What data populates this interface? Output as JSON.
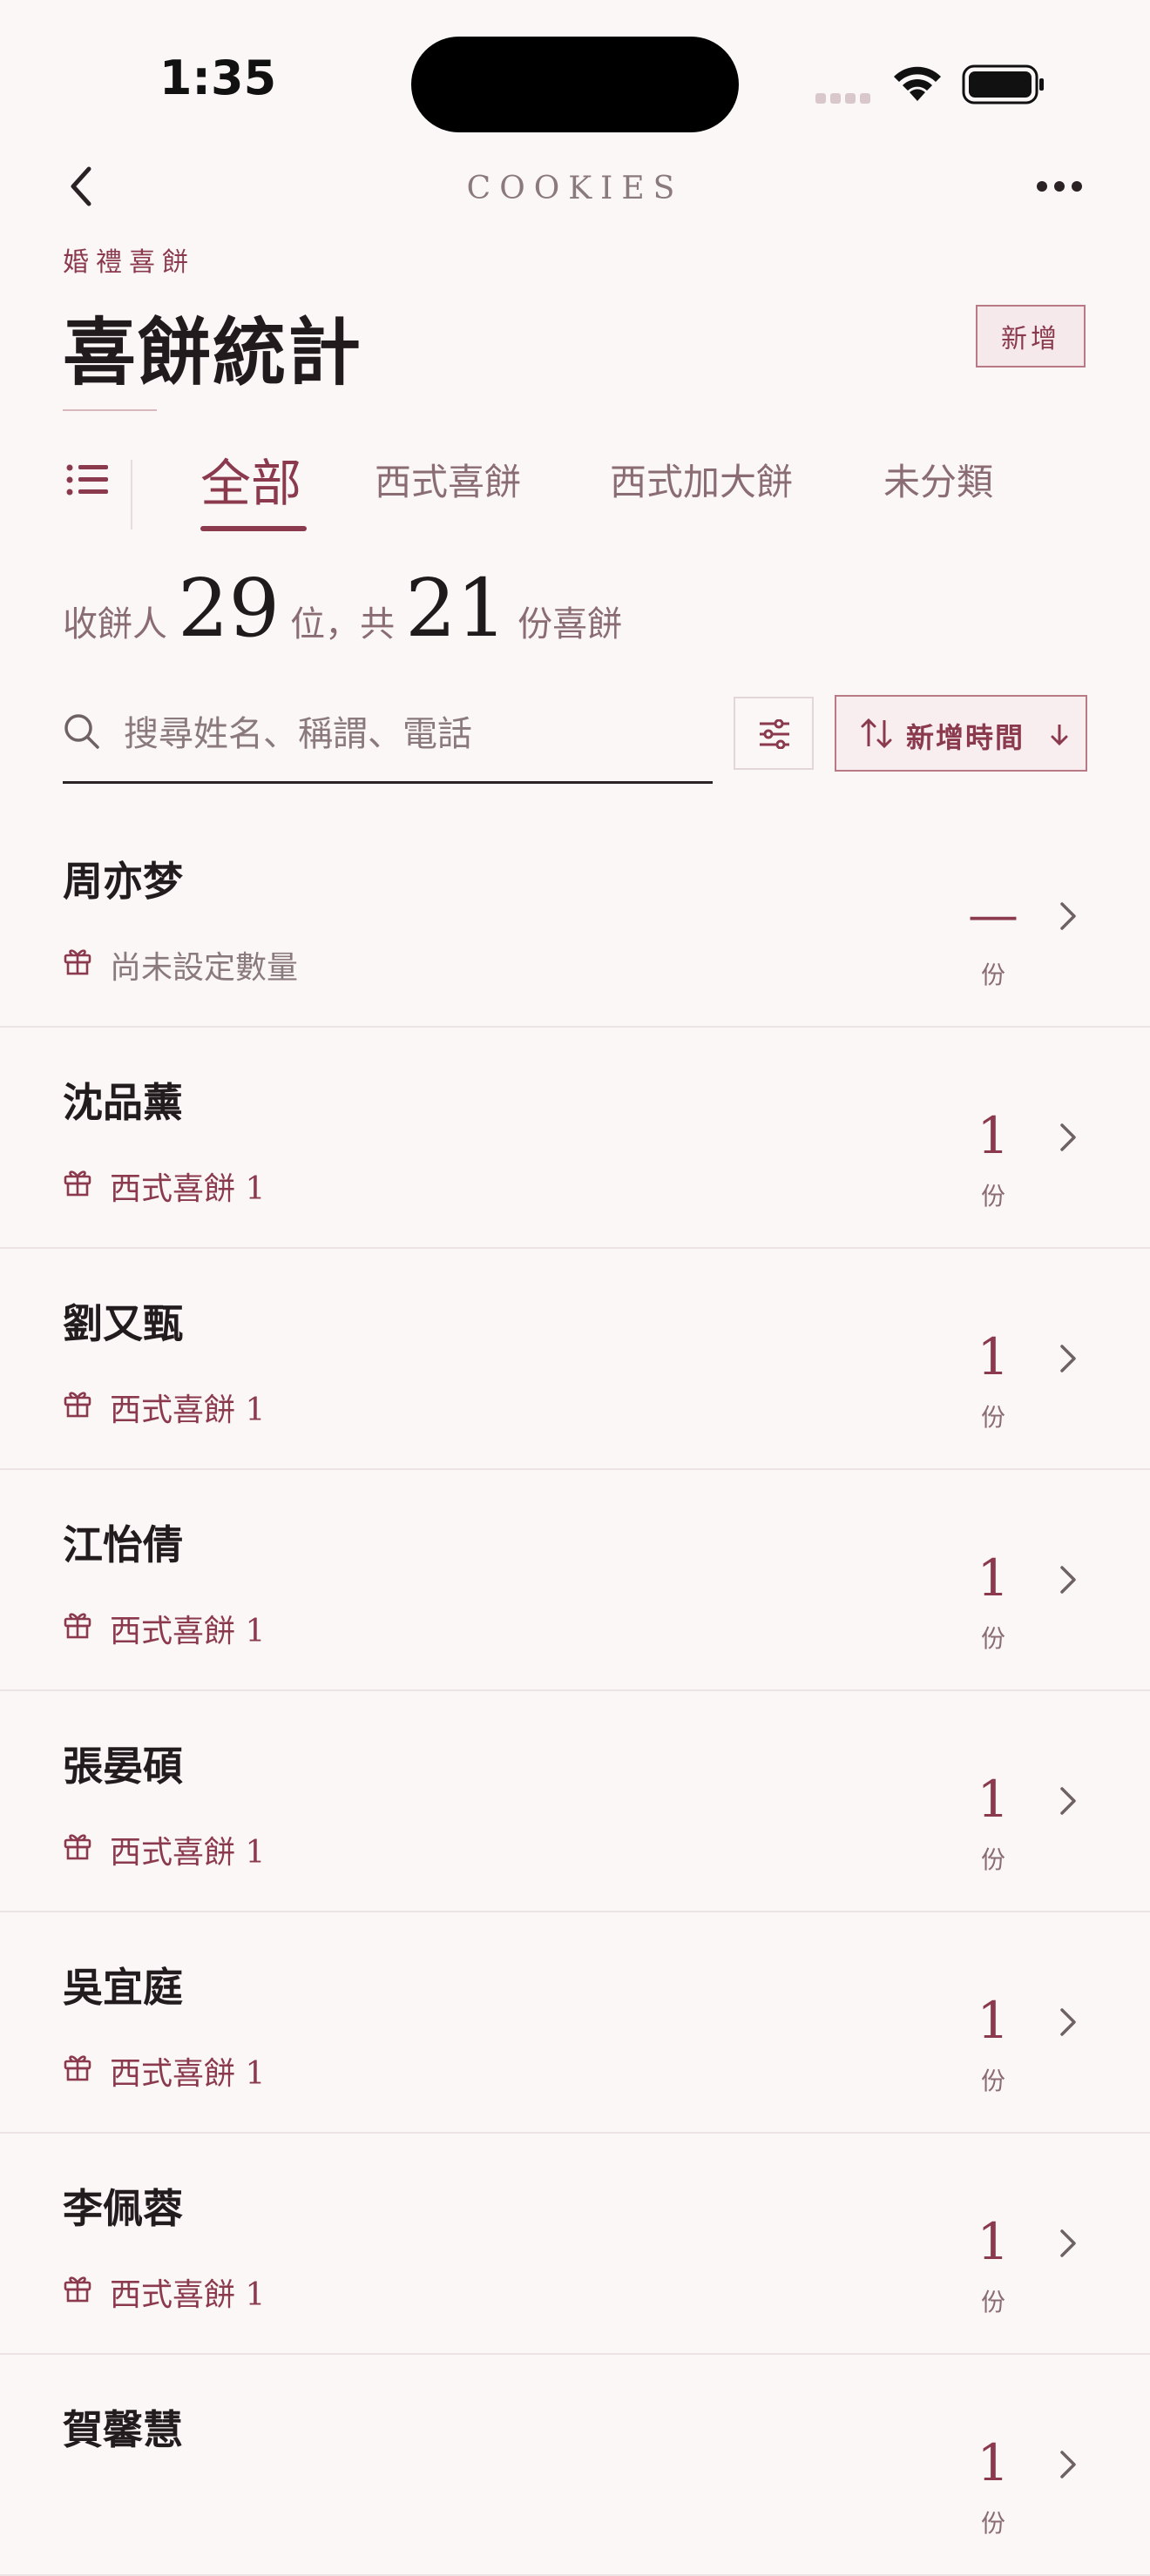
{
  "status_bar": {
    "time": "1:35"
  },
  "nav": {
    "title": "COOKIES"
  },
  "header": {
    "eyebrow": "婚禮喜餅",
    "title": "喜餅統計",
    "add_label": "新增"
  },
  "tabs": [
    {
      "label": "全部",
      "active": true
    },
    {
      "label": "西式喜餅",
      "active": false
    },
    {
      "label": "西式加大餅",
      "active": false
    },
    {
      "label": "未分類",
      "active": false
    }
  ],
  "summary": {
    "prefix": "收餅人",
    "recipients": "29",
    "mid": "位，共",
    "boxes": "21",
    "suffix": "份喜餅"
  },
  "search": {
    "placeholder": "搜尋姓名、稱謂、電話",
    "value": ""
  },
  "sort": {
    "label": "新增時間"
  },
  "list": [
    {
      "name": "周亦梦",
      "meta": "尚未設定數量",
      "qty": "—",
      "unit": "份",
      "unset": true
    },
    {
      "name": "沈品薰",
      "meta": "西式喜餅 1",
      "qty": "1",
      "unit": "份"
    },
    {
      "name": "劉又甄",
      "meta": "西式喜餅 1",
      "qty": "1",
      "unit": "份"
    },
    {
      "name": "江怡倩",
      "meta": "西式喜餅 1",
      "qty": "1",
      "unit": "份"
    },
    {
      "name": "張晏碩",
      "meta": "西式喜餅 1",
      "qty": "1",
      "unit": "份"
    },
    {
      "name": "吳宜庭",
      "meta": "西式喜餅 1",
      "qty": "1",
      "unit": "份"
    },
    {
      "name": "李佩蓉",
      "meta": "西式喜餅 1",
      "qty": "1",
      "unit": "份"
    },
    {
      "name": "賀馨慧",
      "meta": "",
      "qty": "1",
      "unit": "份"
    }
  ],
  "colors": {
    "accent": "#8b3a4e",
    "background": "#fbf7f6",
    "text": "#1f1a1b"
  }
}
